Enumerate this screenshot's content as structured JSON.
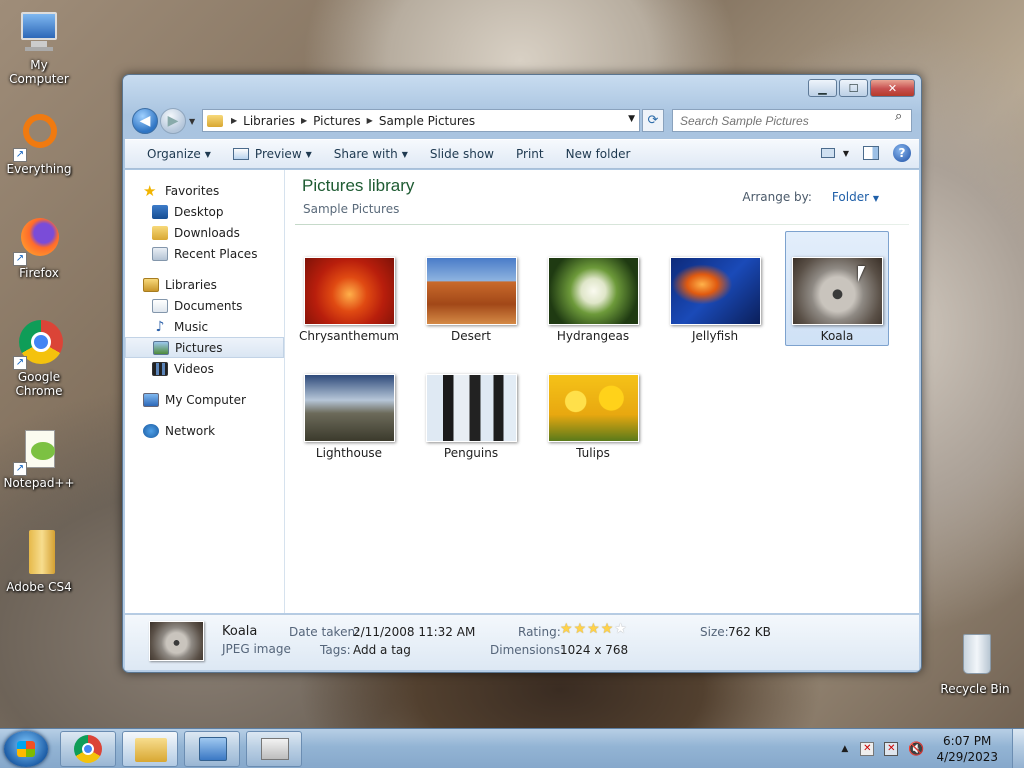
{
  "desktop": {
    "icons": [
      {
        "label": "My Computer",
        "icon": "computer-icon"
      },
      {
        "label": "Everything",
        "icon": "everything-icon"
      },
      {
        "label": "Firefox",
        "icon": "firefox-icon"
      },
      {
        "label": "Google Chrome",
        "icon": "chrome-icon"
      },
      {
        "label": "Notepad++",
        "icon": "notepadpp-icon"
      },
      {
        "label": "Adobe CS4",
        "icon": "folder-icon"
      },
      {
        "label": "Recycle Bin",
        "icon": "recycle-bin-icon"
      }
    ]
  },
  "window": {
    "address": {
      "crumbs": [
        "Libraries",
        "Pictures",
        "Sample Pictures"
      ]
    },
    "search": {
      "placeholder": "Search Sample Pictures"
    },
    "toolbar": {
      "organize": "Organize",
      "preview": "Preview",
      "share_with": "Share with",
      "slide_show": "Slide show",
      "print": "Print",
      "new_folder": "New folder"
    },
    "nav": {
      "favorites": "Favorites",
      "desktop": "Desktop",
      "downloads": "Downloads",
      "recent_places": "Recent Places",
      "libraries": "Libraries",
      "documents": "Documents",
      "music": "Music",
      "pictures": "Pictures",
      "videos": "Videos",
      "my_computer": "My Computer",
      "network": "Network"
    },
    "library": {
      "title": "Pictures library",
      "subtitle": "Sample Pictures",
      "arrange_label": "Arrange by:",
      "arrange_value": "Folder"
    },
    "items": [
      {
        "name": "Chrysanthemum",
        "selected": false
      },
      {
        "name": "Desert",
        "selected": false
      },
      {
        "name": "Hydrangeas",
        "selected": false
      },
      {
        "name": "Jellyfish",
        "selected": false
      },
      {
        "name": "Koala",
        "selected": true
      },
      {
        "name": "Lighthouse",
        "selected": false
      },
      {
        "name": "Penguins",
        "selected": false
      },
      {
        "name": "Tulips",
        "selected": false
      }
    ],
    "details": {
      "name": "Koala",
      "type": "JPEG image",
      "date_label": "Date taken:",
      "date_value": "2/11/2008 11:32 AM",
      "tags_label": "Tags:",
      "tags_value": "Add a tag",
      "rating_label": "Rating:",
      "rating": 4,
      "rating_max": 5,
      "dimensions_label": "Dimensions:",
      "dimensions_value": "1024 x 768",
      "size_label": "Size:",
      "size_value": "762 KB"
    }
  },
  "taskbar": {
    "clock_time": "6:07 PM",
    "clock_date": "4/29/2023",
    "tray_arrow": "▲"
  }
}
